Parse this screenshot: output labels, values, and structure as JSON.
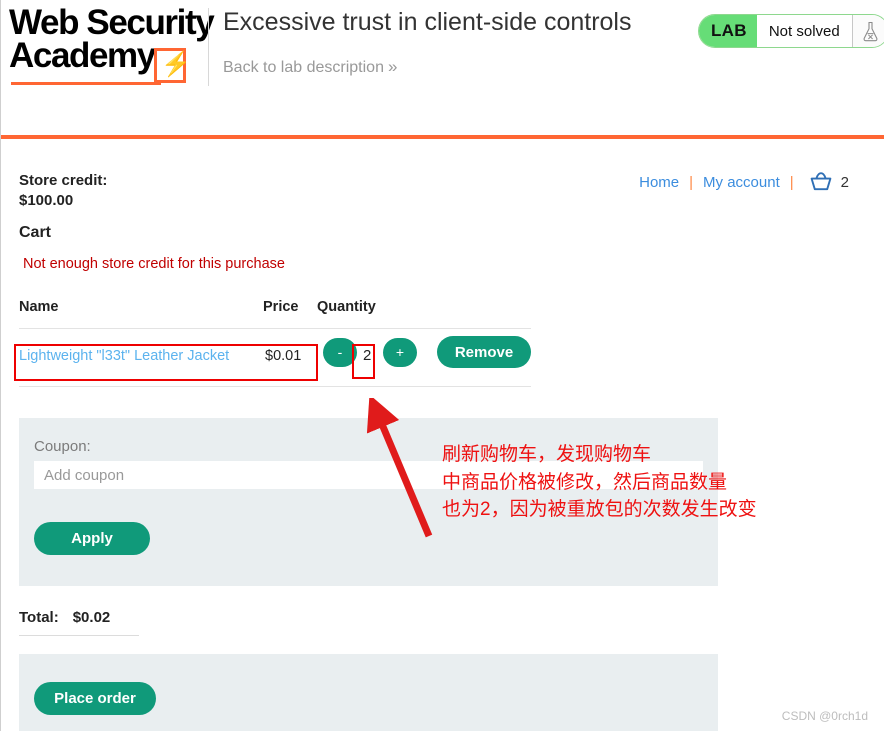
{
  "header": {
    "logo_line1": "Web Security",
    "logo_line2": "Academy",
    "logo_icon": "lightning-bolt-icon",
    "lab_title": "Excessive trust in client-side controls",
    "back_link": "Back to lab description",
    "back_chevron": "»",
    "badge": {
      "tag": "LAB",
      "status": "Not solved",
      "icon": "flask-icon"
    },
    "accent_color": "#ff6633",
    "badge_green": "#66dd77"
  },
  "account": {
    "credit_label": "Store credit:",
    "credit_value": "$100.00"
  },
  "nav": {
    "home": "Home",
    "my_account": "My account",
    "separator": "|",
    "cart_icon": "basket-icon",
    "cart_count": "2",
    "link_color": "#3c8dde"
  },
  "cart": {
    "heading": "Cart",
    "error": "Not enough store credit for this purchase",
    "columns": [
      "Name",
      "Price",
      "Quantity"
    ],
    "rows": [
      {
        "name": "Lightweight \"l33t\" Leather Jacket",
        "price": "$0.01",
        "qty": "2",
        "minus_label": "-",
        "plus_label": "+",
        "remove_label": "Remove"
      }
    ],
    "total_label": "Total:",
    "total_value": "$0.02",
    "button_color": "#109a7a"
  },
  "coupon": {
    "label": "Coupon:",
    "placeholder": "Add coupon",
    "value": "",
    "apply_label": "Apply"
  },
  "order": {
    "place_order_label": "Place order"
  },
  "annotations": {
    "color": "#ee1111",
    "line1": "刷新购物车，发现购物车",
    "line2": "中商品价格被修改，然后商品数量",
    "line3": "也为2，因为被重放包的次数发生改变"
  },
  "watermark": "CSDN @0rch1d"
}
